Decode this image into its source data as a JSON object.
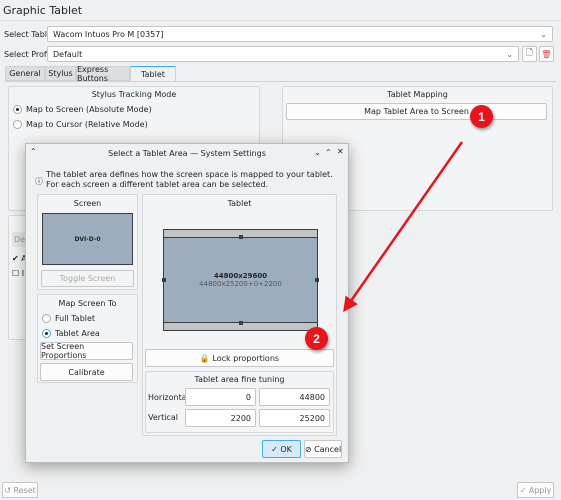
{
  "window": {
    "title": "Graphic Tablet"
  },
  "select_tablet": {
    "label": "Select Tablet:",
    "value": "Wacom Intuos Pro M [0357]"
  },
  "select_profile": {
    "label": "Select Profile:",
    "value": "Default"
  },
  "tabs": [
    {
      "label": "General"
    },
    {
      "label": "Stylus"
    },
    {
      "label": "Express Buttons"
    },
    {
      "label": "Tablet",
      "active": true
    }
  ],
  "stylus_tracking": {
    "title": "Stylus Tracking Mode",
    "options": [
      {
        "label": "Map to Screen (Absolute Mode)",
        "selected": true
      },
      {
        "label": "Map to Cursor (Relative Mode)",
        "selected": false
      }
    ]
  },
  "tablet_mapping": {
    "title": "Tablet Mapping",
    "button": "Map Tablet Area to Screen"
  },
  "hidden_group": {
    "combo_fragment": "Def",
    "check1_fragment": "A",
    "check2_fragment": "I"
  },
  "footer": {
    "reset": "Reset",
    "apply": "Apply"
  },
  "dialog": {
    "title": "Select a Tablet Area — System Settings",
    "info": "The tablet area defines how the screen space is mapped to your tablet. For each screen a different tablet area can be selected.",
    "screen": {
      "title": "Screen",
      "name": "DVI-D-0",
      "toggle": "Toggle Screen"
    },
    "map_to": {
      "title": "Map Screen To",
      "options": [
        {
          "label": "Full Tablet",
          "selected": false
        },
        {
          "label": "Tablet Area",
          "selected": true
        }
      ],
      "proportions": "Set Screen Proportions",
      "calibrate": "Calibrate"
    },
    "tablet": {
      "title": "Tablet",
      "size": "44800x29600",
      "area": "44800x25200+0+2200",
      "lock": "Lock proportions"
    },
    "fine": {
      "title": "Tablet area fine tuning",
      "horizontal_label": "Horizontal",
      "vertical_label": "Vertical",
      "h_start": "0",
      "h_end": "44800",
      "v_start": "2200",
      "v_end": "25200"
    },
    "ok": "OK",
    "cancel": "Cancel"
  },
  "annotations": {
    "marker1": "1",
    "marker2": "2",
    "color": "#e8141c"
  },
  "colors": {
    "accent": "#3daee9",
    "area": "#9eadbd"
  }
}
